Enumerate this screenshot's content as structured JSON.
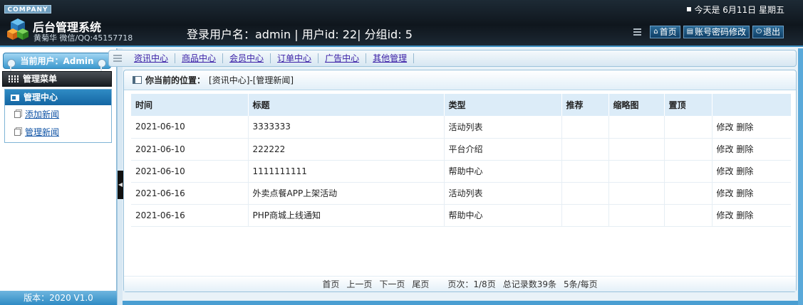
{
  "header": {
    "company": "COMPANY",
    "title": "后台管理系统",
    "subtitle": "黄菊华 微信/QQ:45157718",
    "login_info": "登录用户名：admin | 用户id: 22| 分组id: 5",
    "date": "今天是 6月11日 星期五",
    "buttons": [
      {
        "label": "首页",
        "icon": "home-icon"
      },
      {
        "label": "账号密码修改",
        "icon": "account-icon"
      },
      {
        "label": "退出",
        "icon": "power-icon"
      }
    ]
  },
  "sidebar": {
    "current_user": "当前用户：Admin",
    "menu_title": "管理菜单",
    "group_title": "管理中心",
    "items": [
      {
        "label": "添加新闻"
      },
      {
        "label": "管理新闻"
      }
    ],
    "version": "版本：2020 V1.0"
  },
  "topnav": {
    "items": [
      "资讯中心",
      "商品中心",
      "会员中心",
      "订单中心",
      "广告中心",
      "其他管理"
    ]
  },
  "main": {
    "crumb_label": "你当前的位置：",
    "crumb_path": "[资讯中心]-[管理新闻]",
    "columns": [
      "时间",
      "标题",
      "类型",
      "推荐",
      "缩略图",
      "置顶",
      ""
    ],
    "rows": [
      {
        "time": "2021-06-10",
        "title": "3333333",
        "type": "活动列表",
        "edit": "修改",
        "delete": "删除"
      },
      {
        "time": "2021-06-10",
        "title": "222222",
        "type": "平台介绍",
        "edit": "修改",
        "delete": "删除"
      },
      {
        "time": "2021-06-10",
        "title": "1111111111",
        "type": "帮助中心",
        "edit": "修改",
        "delete": "删除"
      },
      {
        "time": "2021-06-16",
        "title": "外卖点餐APP上架活动",
        "type": "活动列表",
        "edit": "修改",
        "delete": "删除"
      },
      {
        "time": "2021-06-16",
        "title": "PHP商城上线通知",
        "type": "帮助中心",
        "edit": "修改",
        "delete": "删除"
      }
    ],
    "pager": {
      "first": "首页",
      "prev": "上一页",
      "next": "下一页",
      "last": "尾页",
      "page_info": "页次：1/8页",
      "total": "总记录数39条",
      "per_page": "5条/每页"
    }
  },
  "colors": {
    "header_bg": "#141c24",
    "accent_blue": "#2f8bc4",
    "link": "#0e52a5",
    "table_head": "#dcecf8"
  }
}
